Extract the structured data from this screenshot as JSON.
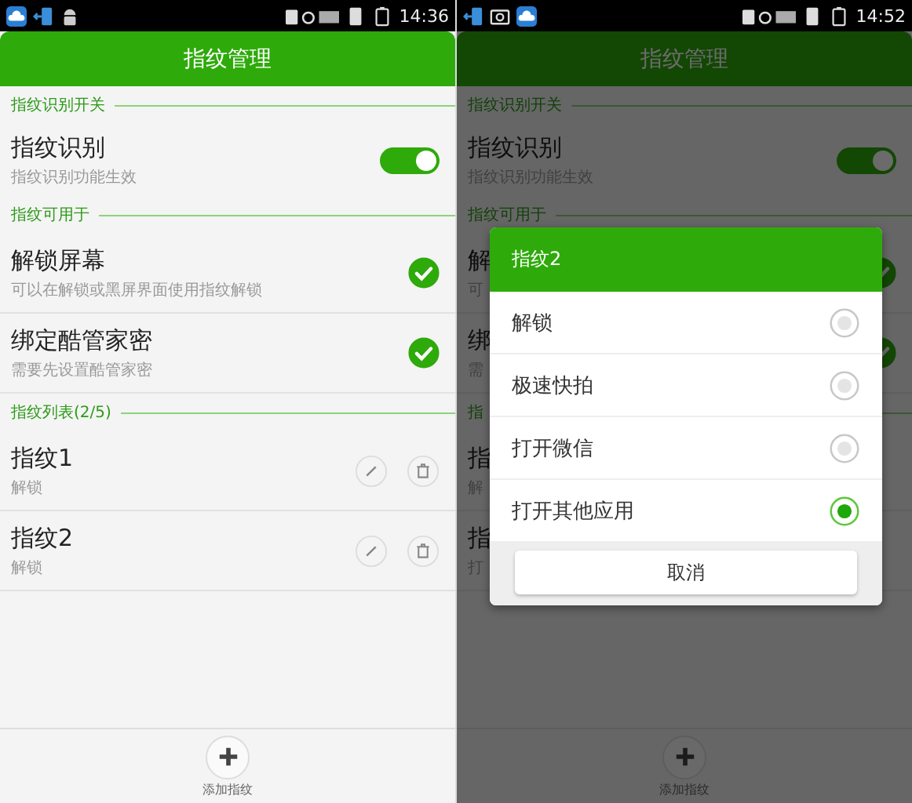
{
  "screens": [
    {
      "status_icons": [
        {
          "kind": "cloud"
        },
        {
          "kind": "sim"
        },
        {
          "kind": "android"
        }
      ],
      "time": "14:36",
      "title": "指纹管理",
      "sections": [
        {
          "label": "指纹识别开关",
          "rows": [
            {
              "kind": "toggle",
              "title": "指纹识别",
              "subtitle": "指纹识别功能生效",
              "on": true
            }
          ]
        },
        {
          "label": "指纹可用于",
          "rows": [
            {
              "kind": "check",
              "title": "解锁屏幕",
              "subtitle": "可以在解锁或黑屏界面使用指纹解锁",
              "checked": true
            },
            {
              "kind": "check",
              "title": "绑定酷管家密",
              "subtitle": "需要先设置酷管家密",
              "checked": true
            }
          ]
        },
        {
          "label": "指纹列表(2/5)",
          "rows": [
            {
              "kind": "fingerprint",
              "title": "指纹1",
              "subtitle": "解锁",
              "actions": true
            },
            {
              "kind": "fingerprint",
              "title": "指纹2",
              "subtitle": "解锁",
              "actions": true
            }
          ]
        }
      ],
      "add_button": {
        "label": "添加指纹"
      }
    },
    {
      "status_icons": [
        {
          "kind": "sim"
        },
        {
          "kind": "camera"
        },
        {
          "kind": "cloud"
        }
      ],
      "time": "14:52",
      "title": "指纹管理",
      "sections": [
        {
          "label": "指纹识别开关",
          "rows": [
            {
              "kind": "toggle",
              "title": "指纹识别",
              "subtitle": "指纹识别功能生效",
              "on": true
            }
          ]
        },
        {
          "label": "指纹可用于",
          "rows": [
            {
              "kind": "check",
              "title": "解",
              "subtitle": "可",
              "checked": true
            },
            {
              "kind": "check",
              "title": "绑",
              "subtitle": "需",
              "checked": true
            }
          ]
        },
        {
          "label": "指",
          "rows": [
            {
              "kind": "fingerprint",
              "title": "指",
              "subtitle": "解",
              "actions": false
            },
            {
              "kind": "fingerprint",
              "title": "指",
              "subtitle": "打",
              "actions": false
            }
          ]
        }
      ],
      "add_button": {
        "label": "添加指纹"
      },
      "dialog": {
        "title": "指纹2",
        "options": [
          {
            "label": "解锁",
            "selected": false
          },
          {
            "label": "极速快拍",
            "selected": false
          },
          {
            "label": "打开微信",
            "selected": false
          },
          {
            "label": "打开其他应用",
            "selected": true
          }
        ],
        "cancel": "取消"
      }
    }
  ]
}
